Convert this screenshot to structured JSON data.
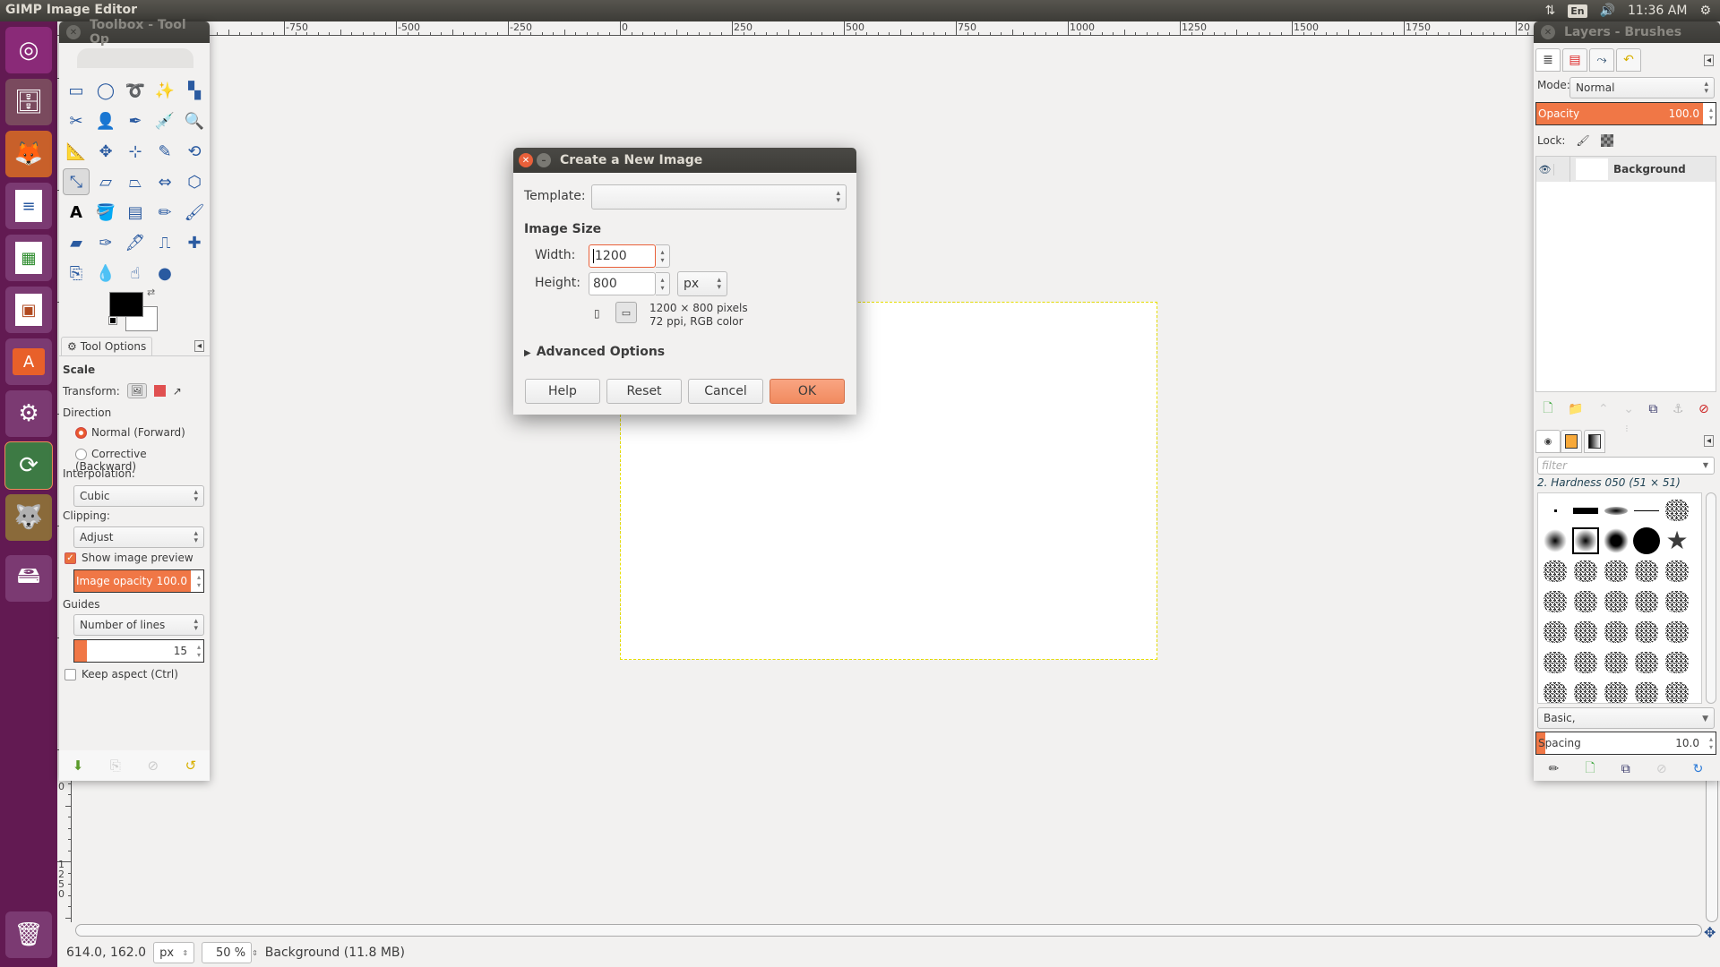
{
  "topbar": {
    "app_title": "GIMP Image Editor",
    "tray": {
      "network_icon": "network-updown-icon",
      "keyboard_layout": "En",
      "volume_icon": "volume-icon",
      "clock": "11:36 AM",
      "settings_icon": "gear-icon"
    }
  },
  "launcher": {
    "items": [
      {
        "name": "ubuntu-dash",
        "icon": "ubuntu-logo-icon",
        "color": "#8a2a78"
      },
      {
        "name": "files",
        "icon": "file-cabinet-icon",
        "color": "#7a4a5e"
      },
      {
        "name": "firefox",
        "icon": "firefox-icon",
        "color": "#c8602a"
      },
      {
        "name": "libreoffice-writer",
        "icon": "writer-document-icon",
        "color": "#7b3a72"
      },
      {
        "name": "libreoffice-calc",
        "icon": "calc-spreadsheet-icon",
        "color": "#7b3a72"
      },
      {
        "name": "libreoffice-impress",
        "icon": "impress-presentation-icon",
        "color": "#7b3a72"
      },
      {
        "name": "ubuntu-software",
        "icon": "software-bag-icon",
        "color": "#7b3a72"
      },
      {
        "name": "system-settings",
        "icon": "wrench-gear-icon",
        "color": "#7b3a72"
      },
      {
        "name": "software-updater",
        "icon": "updater-icon",
        "color": "#3d7a44"
      },
      {
        "name": "gimp",
        "icon": "gimp-wilber-icon",
        "color": "#8a6a3a"
      },
      {
        "name": "disk",
        "icon": "hard-disk-icon",
        "color": "#7b3a72"
      },
      {
        "name": "trash",
        "icon": "trash-icon",
        "color": "#7b3a72"
      }
    ]
  },
  "ruler": {
    "horizontal_labels": [
      "-750",
      "-500",
      "-250",
      "0",
      "250",
      "500",
      "750",
      "1000",
      "1250",
      "1500",
      "1750",
      "20"
    ],
    "vertical_labels": [
      "0",
      "1250"
    ]
  },
  "toolbox": {
    "title": "Toolbox - Tool Op",
    "tools": [
      {
        "name": "rect-select",
        "glyph": "▭"
      },
      {
        "name": "ellipse-select",
        "glyph": "◯"
      },
      {
        "name": "free-select",
        "glyph": "➰"
      },
      {
        "name": "fuzzy-select",
        "glyph": "✨"
      },
      {
        "name": "select-by-color",
        "glyph": "▚"
      },
      {
        "name": "scissors-select",
        "glyph": "✂"
      },
      {
        "name": "foreground-select",
        "glyph": "👤"
      },
      {
        "name": "paths",
        "glyph": "✒"
      },
      {
        "name": "color-picker",
        "glyph": "💉"
      },
      {
        "name": "zoom",
        "glyph": "🔍"
      },
      {
        "name": "measure",
        "glyph": "📐"
      },
      {
        "name": "move",
        "glyph": "✥"
      },
      {
        "name": "align",
        "glyph": "⊹"
      },
      {
        "name": "crop",
        "glyph": "✎"
      },
      {
        "name": "rotate",
        "glyph": "⟲"
      },
      {
        "name": "scale",
        "glyph": "⤡"
      },
      {
        "name": "shear",
        "glyph": "▱"
      },
      {
        "name": "perspective",
        "glyph": "⏢"
      },
      {
        "name": "flip",
        "glyph": "⇔"
      },
      {
        "name": "cage-transform",
        "glyph": "⬡"
      },
      {
        "name": "text",
        "glyph": "A"
      },
      {
        "name": "bucket-fill",
        "glyph": "🪣"
      },
      {
        "name": "blend",
        "glyph": "▤"
      },
      {
        "name": "pencil",
        "glyph": "✏"
      },
      {
        "name": "paintbrush",
        "glyph": "🖌"
      },
      {
        "name": "eraser",
        "glyph": "▰"
      },
      {
        "name": "airbrush",
        "glyph": "✑"
      },
      {
        "name": "ink",
        "glyph": "🖋"
      },
      {
        "name": "clone",
        "glyph": "⎍"
      },
      {
        "name": "heal",
        "glyph": "✚"
      },
      {
        "name": "perspective-clone",
        "glyph": "⎘"
      },
      {
        "name": "blur-sharpen",
        "glyph": "💧"
      },
      {
        "name": "smudge",
        "glyph": "☝"
      },
      {
        "name": "dodge-burn",
        "glyph": "●"
      }
    ],
    "selected_tool": "scale",
    "foreground_color": "#000000",
    "background_color": "#ffffff"
  },
  "tool_options": {
    "tab_label": "Tool Options",
    "tool_name": "Scale",
    "transform_label": "Transform:",
    "direction_label": "Direction",
    "direction_options": [
      "Normal (Forward)",
      "Corrective (Backward)"
    ],
    "direction_selected": "Normal (Forward)",
    "interpolation_label": "Interpolation:",
    "interpolation_value": "Cubic",
    "clipping_label": "Clipping:",
    "clipping_value": "Adjust",
    "show_preview_label": "Show image preview",
    "show_preview_checked": true,
    "image_opacity_label": "Image opacity",
    "image_opacity_value": "100.0",
    "image_opacity_fraction": 1.0,
    "guides_label": "Guides",
    "guides_value": "Number of lines",
    "guides_lines": "15",
    "guides_lines_fraction": 0.1,
    "keep_aspect_label": "Keep aspect  (Ctrl)",
    "keep_aspect_checked": false
  },
  "dialog": {
    "title": "Create a New Image",
    "template_label": "Template:",
    "template_value": "",
    "image_size_label": "Image Size",
    "width_label": "Width:",
    "width_value": "1200",
    "height_label": "Height:",
    "height_value": "800",
    "unit": "px",
    "info_line1": "1200 × 800 pixels",
    "info_line2": "72 ppi, RGB color",
    "advanced_label": "Advanced Options",
    "buttons": {
      "help": "Help",
      "reset": "Reset",
      "cancel": "Cancel",
      "ok": "OK"
    }
  },
  "layers_dock": {
    "title": "Layers - Brushes",
    "mode_label": "Mode:",
    "mode_value": "Normal",
    "opacity_label": "Opacity",
    "opacity_value": "100.0",
    "opacity_fraction": 1.0,
    "lock_label": "Lock:",
    "layers": [
      {
        "name": "Background",
        "visible": true
      }
    ]
  },
  "brushes_dock": {
    "filter_placeholder": "filter",
    "selected_brush": "2. Hardness 050 (51 × 51)",
    "brush_set": "Basic,",
    "spacing_label": "Spacing",
    "spacing_value": "10.0",
    "spacing_fraction": 0.05
  },
  "statusbar": {
    "coords": "614.0, 162.0",
    "unit": "px",
    "zoom": "50 %",
    "layer_info": "Background (11.8 MB)"
  },
  "colors": {
    "accent": "#f07746",
    "launcher_bg": "#621a52",
    "titlebar": "#3c3b37"
  }
}
